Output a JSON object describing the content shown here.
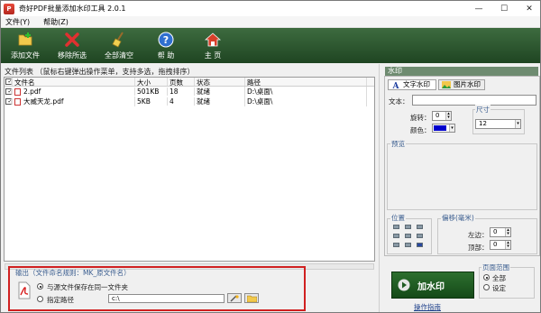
{
  "window": {
    "title": "奇好PDF批量添加水印工具 2.0.1",
    "min": "—",
    "max": "☐",
    "close": "✕"
  },
  "menu": [
    "文件(Y)",
    "帮助(Z)"
  ],
  "toolbar": [
    {
      "label": "添加文件",
      "icon": "add-file-icon"
    },
    {
      "label": "移除所选",
      "icon": "remove-icon"
    },
    {
      "label": "全部清空",
      "icon": "broom-icon"
    },
    {
      "label": "帮 助",
      "icon": "help-icon"
    },
    {
      "label": "主 页",
      "icon": "home-icon"
    }
  ],
  "file_list": {
    "caption": "文件列表 （鼠标右键弹出操作菜单，支持多选，拖拽排序）",
    "columns": [
      "文件名",
      "大小",
      "页数",
      "状态",
      "路径"
    ],
    "rows": [
      {
        "name": "2.pdf",
        "size": "501KB",
        "pages": "18",
        "status": "就绪",
        "path": "D:\\桌面\\"
      },
      {
        "name": "大威天龙.pdf",
        "size": "5KB",
        "pages": "4",
        "status": "就绪",
        "path": "D:\\桌面\\"
      }
    ]
  },
  "watermark": {
    "caption": "水印",
    "tab_text": "文字水印",
    "tab_image": "图片水印",
    "text_label": "文本：",
    "rotate_label": "旋转：",
    "rotate_value": "0",
    "color_label": "颜色：",
    "size_label": "尺寸",
    "size_value": "12",
    "preview_label": "预览",
    "position_label": "位置",
    "offset_label": "偏移(毫米)",
    "left_label": "左边：",
    "left_value": "0",
    "top_label": "顶部：",
    "top_value": "0",
    "color_value": "#0000cc"
  },
  "output": {
    "caption": "输出（文件命名规则：MK_原文件名）",
    "same_folder": "与源文件保存在同一文件夹",
    "custom_path": "指定路径",
    "path_value": "c:\\"
  },
  "page_range": {
    "caption": "页面范围",
    "all": "全部",
    "custom": "设定"
  },
  "actions": {
    "go": "加水印",
    "guide": "操作指南"
  },
  "accent": "#1f4522"
}
